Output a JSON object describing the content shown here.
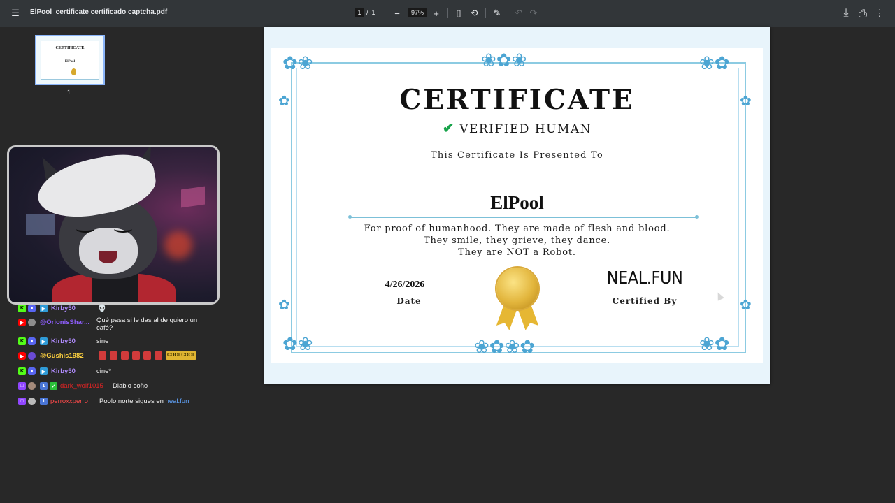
{
  "toolbar": {
    "title": "ElPool_certificate certificado captcha.pdf",
    "page_current": "1",
    "page_sep": "/",
    "page_total": "1",
    "zoom": "97%",
    "menu_icon": "☰",
    "zoom_out_icon": "−",
    "zoom_in_icon": "+",
    "fit_icon": "▯",
    "rotate_icon": "⟲",
    "annotate_icon": "✎",
    "undo_icon": "↶",
    "redo_icon": "↷",
    "download_icon": "⤓",
    "print_icon": "⎙",
    "more_icon": "⋮"
  },
  "thumbnail": {
    "page_number": "1",
    "mini_title": "CERTIFICATE",
    "mini_name": "ElPool"
  },
  "chat": [
    {
      "platform": "kick",
      "user": "Kirby50",
      "user_color": "#b18cff",
      "text": "💀",
      "bot": true
    },
    {
      "platform": "youtube",
      "user": "@OrionisShar...",
      "user_color": "#8b5cf6",
      "text": "Qué pasa si le das al de quiero un",
      "text2": "café?"
    },
    {
      "platform": "kick",
      "user": "Kirby50",
      "user_color": "#b18cff",
      "text": "sine",
      "bot": true
    },
    {
      "platform": "youtube",
      "user": "@Gushis1982",
      "user_color": "#ffd23f",
      "text": "",
      "emotes": true,
      "emote_text": "COOLCOOL"
    },
    {
      "platform": "kick",
      "user": "Kirby50",
      "user_color": "#b18cff",
      "text": "cine*",
      "bot": true
    },
    {
      "platform": "twitch",
      "user": "dark_wolf1015",
      "user_color": "#e02424",
      "text": "Diablo coño",
      "badge": "1",
      "sub": true
    },
    {
      "platform": "twitch",
      "user": "perroxxperro",
      "user_color": "#ff4a4a",
      "text": "Poolo norte sigues en ",
      "link": "neal.fun",
      "badge": "1"
    }
  ],
  "certificate": {
    "title": "CERTIFICATE",
    "verified": "VERIFIED HUMAN",
    "presented": "This Certificate Is Presented To",
    "name": "ElPool",
    "body_line1": "For proof of humanhood. They are made of flesh and blood.",
    "body_line2": "They smile, they grieve, they dance.",
    "body_line3": "They are NOT a Robot.",
    "date": "4/26/2026",
    "date_label": "Date",
    "signature": "NEAL.FUN",
    "signature_label": "Certified By",
    "accent_color": "#7cc0d8",
    "check_color": "#17a34a"
  }
}
